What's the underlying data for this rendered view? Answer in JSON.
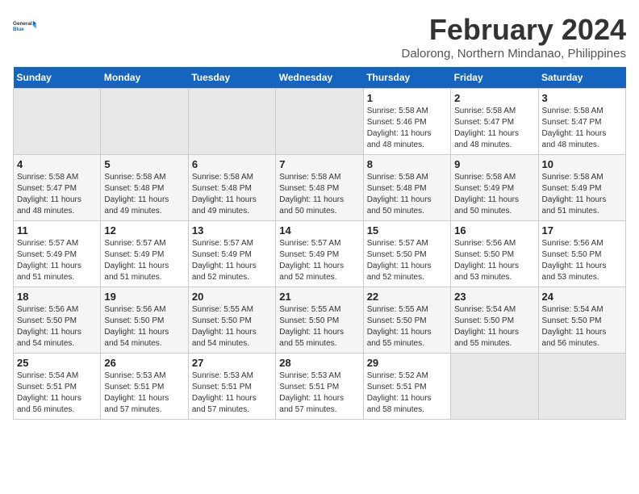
{
  "logo": {
    "line1": "General",
    "line2": "Blue"
  },
  "title": "February 2024",
  "subtitle": "Dalorong, Northern Mindanao, Philippines",
  "days_header": [
    "Sunday",
    "Monday",
    "Tuesday",
    "Wednesday",
    "Thursday",
    "Friday",
    "Saturday"
  ],
  "weeks": [
    [
      {
        "num": "",
        "info": ""
      },
      {
        "num": "",
        "info": ""
      },
      {
        "num": "",
        "info": ""
      },
      {
        "num": "",
        "info": ""
      },
      {
        "num": "1",
        "info": "Sunrise: 5:58 AM\nSunset: 5:46 PM\nDaylight: 11 hours\nand 48 minutes."
      },
      {
        "num": "2",
        "info": "Sunrise: 5:58 AM\nSunset: 5:47 PM\nDaylight: 11 hours\nand 48 minutes."
      },
      {
        "num": "3",
        "info": "Sunrise: 5:58 AM\nSunset: 5:47 PM\nDaylight: 11 hours\nand 48 minutes."
      }
    ],
    [
      {
        "num": "4",
        "info": "Sunrise: 5:58 AM\nSunset: 5:47 PM\nDaylight: 11 hours\nand 48 minutes."
      },
      {
        "num": "5",
        "info": "Sunrise: 5:58 AM\nSunset: 5:48 PM\nDaylight: 11 hours\nand 49 minutes."
      },
      {
        "num": "6",
        "info": "Sunrise: 5:58 AM\nSunset: 5:48 PM\nDaylight: 11 hours\nand 49 minutes."
      },
      {
        "num": "7",
        "info": "Sunrise: 5:58 AM\nSunset: 5:48 PM\nDaylight: 11 hours\nand 50 minutes."
      },
      {
        "num": "8",
        "info": "Sunrise: 5:58 AM\nSunset: 5:48 PM\nDaylight: 11 hours\nand 50 minutes."
      },
      {
        "num": "9",
        "info": "Sunrise: 5:58 AM\nSunset: 5:49 PM\nDaylight: 11 hours\nand 50 minutes."
      },
      {
        "num": "10",
        "info": "Sunrise: 5:58 AM\nSunset: 5:49 PM\nDaylight: 11 hours\nand 51 minutes."
      }
    ],
    [
      {
        "num": "11",
        "info": "Sunrise: 5:57 AM\nSunset: 5:49 PM\nDaylight: 11 hours\nand 51 minutes."
      },
      {
        "num": "12",
        "info": "Sunrise: 5:57 AM\nSunset: 5:49 PM\nDaylight: 11 hours\nand 51 minutes."
      },
      {
        "num": "13",
        "info": "Sunrise: 5:57 AM\nSunset: 5:49 PM\nDaylight: 11 hours\nand 52 minutes."
      },
      {
        "num": "14",
        "info": "Sunrise: 5:57 AM\nSunset: 5:49 PM\nDaylight: 11 hours\nand 52 minutes."
      },
      {
        "num": "15",
        "info": "Sunrise: 5:57 AM\nSunset: 5:50 PM\nDaylight: 11 hours\nand 52 minutes."
      },
      {
        "num": "16",
        "info": "Sunrise: 5:56 AM\nSunset: 5:50 PM\nDaylight: 11 hours\nand 53 minutes."
      },
      {
        "num": "17",
        "info": "Sunrise: 5:56 AM\nSunset: 5:50 PM\nDaylight: 11 hours\nand 53 minutes."
      }
    ],
    [
      {
        "num": "18",
        "info": "Sunrise: 5:56 AM\nSunset: 5:50 PM\nDaylight: 11 hours\nand 54 minutes."
      },
      {
        "num": "19",
        "info": "Sunrise: 5:56 AM\nSunset: 5:50 PM\nDaylight: 11 hours\nand 54 minutes."
      },
      {
        "num": "20",
        "info": "Sunrise: 5:55 AM\nSunset: 5:50 PM\nDaylight: 11 hours\nand 54 minutes."
      },
      {
        "num": "21",
        "info": "Sunrise: 5:55 AM\nSunset: 5:50 PM\nDaylight: 11 hours\nand 55 minutes."
      },
      {
        "num": "22",
        "info": "Sunrise: 5:55 AM\nSunset: 5:50 PM\nDaylight: 11 hours\nand 55 minutes."
      },
      {
        "num": "23",
        "info": "Sunrise: 5:54 AM\nSunset: 5:50 PM\nDaylight: 11 hours\nand 55 minutes."
      },
      {
        "num": "24",
        "info": "Sunrise: 5:54 AM\nSunset: 5:50 PM\nDaylight: 11 hours\nand 56 minutes."
      }
    ],
    [
      {
        "num": "25",
        "info": "Sunrise: 5:54 AM\nSunset: 5:51 PM\nDaylight: 11 hours\nand 56 minutes."
      },
      {
        "num": "26",
        "info": "Sunrise: 5:53 AM\nSunset: 5:51 PM\nDaylight: 11 hours\nand 57 minutes."
      },
      {
        "num": "27",
        "info": "Sunrise: 5:53 AM\nSunset: 5:51 PM\nDaylight: 11 hours\nand 57 minutes."
      },
      {
        "num": "28",
        "info": "Sunrise: 5:53 AM\nSunset: 5:51 PM\nDaylight: 11 hours\nand 57 minutes."
      },
      {
        "num": "29",
        "info": "Sunrise: 5:52 AM\nSunset: 5:51 PM\nDaylight: 11 hours\nand 58 minutes."
      },
      {
        "num": "",
        "info": ""
      },
      {
        "num": "",
        "info": ""
      }
    ]
  ]
}
